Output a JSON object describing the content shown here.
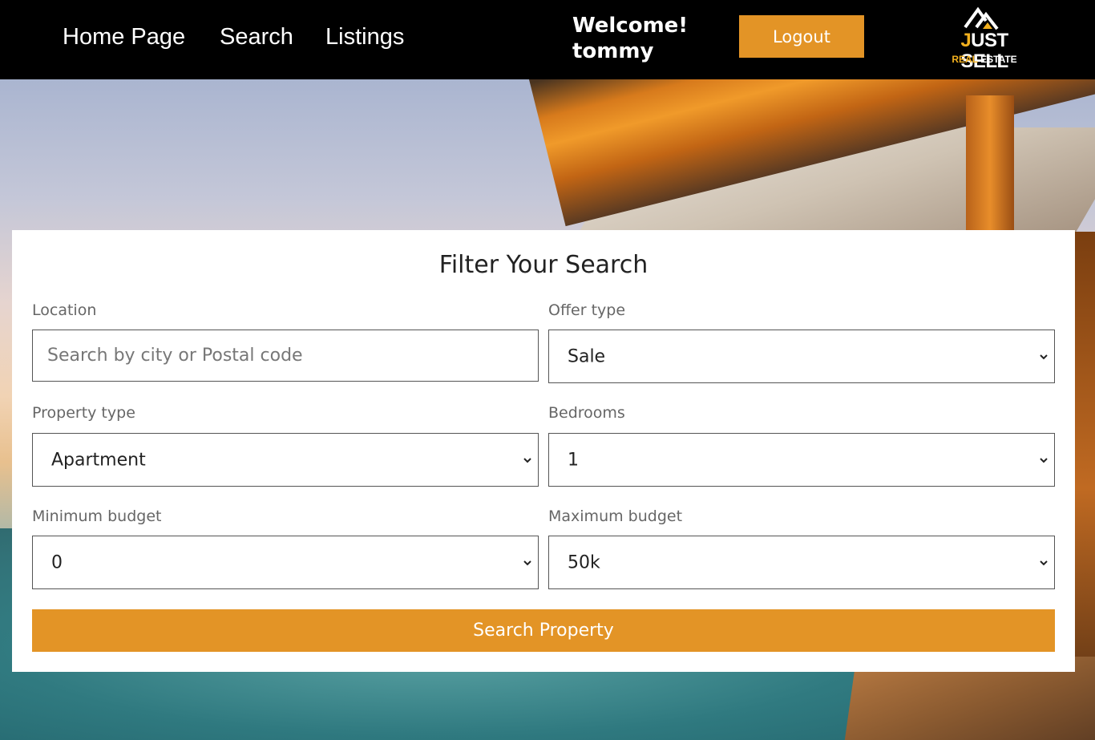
{
  "nav": {
    "links": [
      "Home Page",
      "Search",
      "Listings"
    ],
    "welcome_line1": "Welcome!",
    "welcome_line2": "tommy",
    "logout_label": "Logout"
  },
  "logo": {
    "first_letter": "J",
    "rest": "UST SELL",
    "sub_real": "REAL",
    "sub_estate": " ESTATE",
    "accent_color": "#f2b01e"
  },
  "form": {
    "title": "Filter Your Search",
    "location": {
      "label": "Location",
      "placeholder": "Search by city or Postal code",
      "value": ""
    },
    "offer_type": {
      "label": "Offer type",
      "value": "Sale"
    },
    "property_type": {
      "label": "Property type",
      "value": "Apartment"
    },
    "bedrooms": {
      "label": "Bedrooms",
      "value": "1"
    },
    "min_budget": {
      "label": "Minimum budget",
      "value": "0"
    },
    "max_budget": {
      "label": "Maximum budget",
      "value": "50k"
    },
    "submit_label": "Search Property"
  },
  "colors": {
    "accent": "#e39426",
    "nav_bg": "#000000"
  }
}
